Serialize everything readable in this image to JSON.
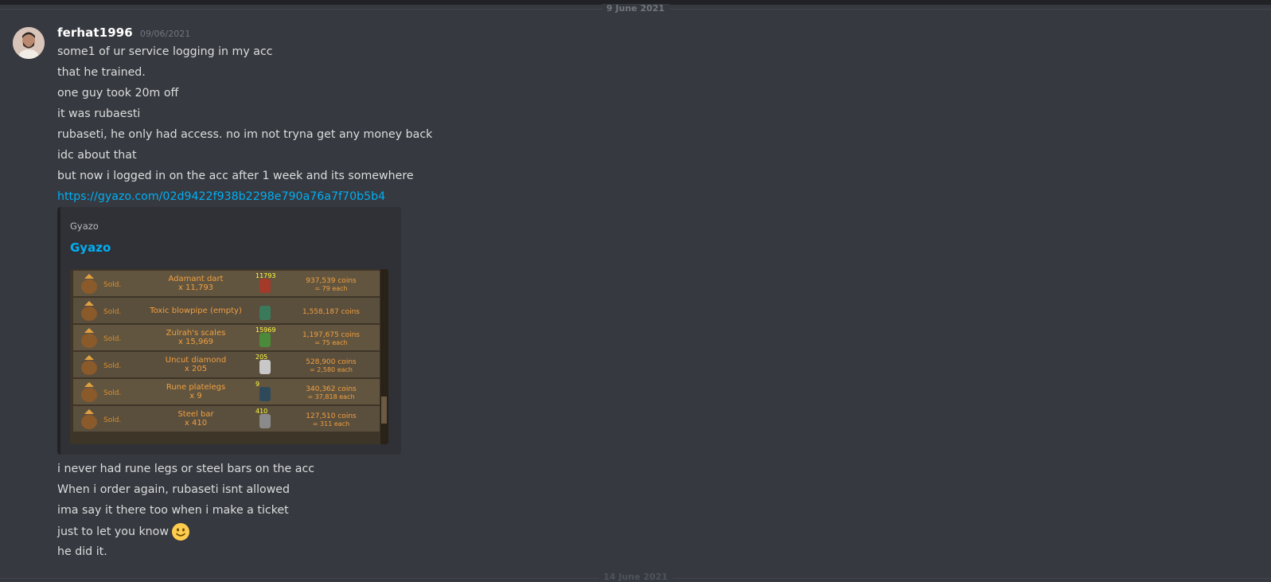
{
  "divider": {
    "top_date": "9 June 2021",
    "bottom_date": "14 June 2021"
  },
  "message": {
    "author": "ferhat1996",
    "timestamp": "09/06/2021",
    "lines_before": [
      "some1 of ur service logging in my acc",
      "that he trained.",
      "one guy took 20m off",
      "it was rubaesti",
      "rubaseti, he only had access. no im not tryna get any money back",
      "idc about that",
      "but now i logged in on the acc after 1 week and its somewhere"
    ],
    "link": "https://gyazo.com/02d9422f938b2298e790a76a7f70b5b4",
    "embed": {
      "provider": "Gyazo",
      "title": "Gyazo",
      "rows": [
        {
          "status": "Sold.",
          "item": "Adamant dart",
          "qty": "x 11,793",
          "count": "11793",
          "coins": "937,539 coins",
          "each": "= 79 each",
          "icon": "dart-icon"
        },
        {
          "status": "Sold.",
          "item": "Toxic blowpipe (empty)",
          "qty": "",
          "count": "",
          "coins": "1,558,187 coins",
          "each": "",
          "icon": "blowpipe-icon"
        },
        {
          "status": "Sold.",
          "item": "Zulrah's scales",
          "qty": "x 15,969",
          "count": "15969",
          "coins": "1,197,675 coins",
          "each": "= 75 each",
          "icon": "scales-icon"
        },
        {
          "status": "Sold.",
          "item": "Uncut diamond",
          "qty": "x 205",
          "count": "205",
          "coins": "528,900 coins",
          "each": "= 2,580 each",
          "icon": "diamond-icon"
        },
        {
          "status": "Sold.",
          "item": "Rune platelegs",
          "qty": "x 9",
          "count": "9",
          "coins": "340,362 coins",
          "each": "= 37,818 each",
          "icon": "platelegs-icon"
        },
        {
          "status": "Sold.",
          "item": "Steel bar",
          "qty": "x 410",
          "count": "410",
          "coins": "127,510 coins",
          "each": "= 311 each",
          "icon": "steel-bar-icon"
        }
      ]
    },
    "lines_after": [
      "i never had rune legs or steel bars on the acc",
      "When i order again, rubaseti isnt allowed",
      "ima say it there too when i make a ticket",
      "just to let you know",
      "he did it."
    ],
    "emoji": "slightly-smiling-face-icon"
  },
  "colors": {
    "background": "#36393f",
    "link": "#00aff4",
    "username": "#ffffff",
    "embed_bg": "#2f3136"
  }
}
